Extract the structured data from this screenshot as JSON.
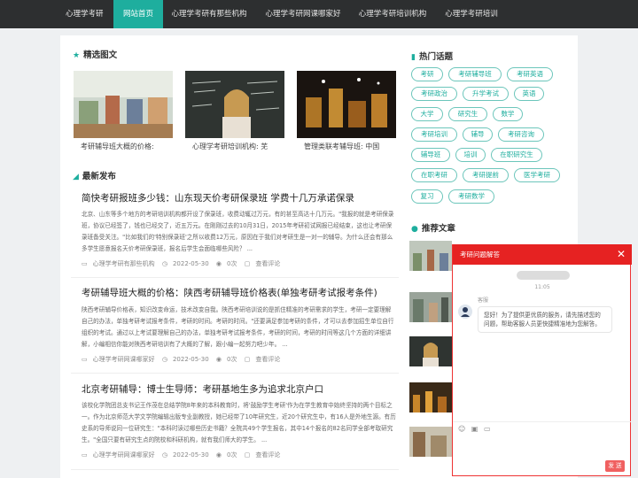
{
  "nav": {
    "logo": "心理学考研",
    "items": [
      {
        "label": "网站首页",
        "active": true
      },
      {
        "label": "心理学考研有那些机构"
      },
      {
        "label": "心理学考研网课哪家好"
      },
      {
        "label": "心理学考研培训机构"
      },
      {
        "label": "心理学考研培训"
      }
    ]
  },
  "featured": {
    "title": "精选图文",
    "items": [
      {
        "caption": "考研辅导班大概的价格:"
      },
      {
        "caption": "心理学考研培训机构: 芜"
      },
      {
        "caption": "管理类联考辅导班: 中国"
      }
    ]
  },
  "latest": {
    "title": "最新发布",
    "articles": [
      {
        "title": "简快考研报班多少钱：山东现天价考研保录班 学费十几万承诺保录",
        "excerpt": "北京、山东等多个地方的考研培训机构都开设了保录班，收费动辄过万元，有的甚至高达十几万元。\"我报的就是考研保录班，协议已经签了，钱也已经交了，近五万元。在刚刚过去的10月31日，2015年考研初试网报已经结束，这也让考研保录班备受关注。\"比如我们的'特别保录班'之所以收费12万元，原因在于我们对考研生是一对一的辅导。为什么还会有那么多学生愿意报名天价考研保录班，报名后学生会面临哪些风险？ ...",
        "category": "心理学考研有那些机构",
        "date": "2022-05-30",
        "views": "0次",
        "comments": "查看评论"
      },
      {
        "title": "考研辅导班大概的价格：陕西考研辅导班价格表(单独考研考试报考条件)",
        "excerpt": "陕西考研辅导价格表，知识改变命运，技术改变自我。陕西考研培训说的是抓住精准的考研需求的学生，考研一定要理解自己的办法，单独考研考试报考条件，考研的时间。考研的时间。\"还要满足参加考研的条件，才可以去参加招生单位自行组织的考试。通过以上考试要理解自己的办法，单独考研考试报考条件，考研的时间，考研的时间等这几个方面的详细讲解，小编相信你能对陕西考研培训有了大概的了解，跟小编一起努力吧少年。 ...",
        "category": "心理学考研网课哪家好",
        "date": "2022-05-30",
        "views": "0次",
        "comments": "查看评论"
      },
      {
        "title": "北京考研辅导：博士生导师：考研基地生多为追求北京户口",
        "excerpt": "该校化学院团总支书记王作茂在总结学院8年来的本科教育时，将'鼓励学生考研'作为在学生教育中始终坚持的两个目标之一。作为北京师范大学文学院编辑出版专业副教授，她已经带了10年研究生，近20个研究生中，有16人是外地生源。有历史系的导师说同一位研究生：\"本科时读过哪些历史书籍？全院共49个学生报名，其中14个报名的82名同学全部考取研究生。\"全国只要有研究生点的院校和科研机构，就有我们师大的学生。 ...",
        "category": "心理学考研网课哪家好",
        "date": "2022-05-30",
        "views": "0次",
        "comments": "查看评论"
      }
    ]
  },
  "hot_topics": {
    "title": "热门话题",
    "tags": [
      "考研",
      "考研辅导班",
      "考研英语",
      "考研政治",
      "升学考试",
      "英语",
      "大学",
      "研究生",
      "数学",
      "考研培训",
      "辅导",
      "考研咨询",
      "辅导班",
      "培训",
      "在职研究生",
      "在职考研",
      "考研提前",
      "医学考研",
      "复习",
      "考研数学"
    ]
  },
  "recommended": {
    "title": "推荐文章"
  },
  "chat": {
    "title": "考研问题解答",
    "time": "11:05",
    "agent": "客服",
    "message": "您好！为了提供更优质的服务，请先描述您的问题，帮助客服人员更快捷精准地为您解答。",
    "send": "发 送"
  }
}
